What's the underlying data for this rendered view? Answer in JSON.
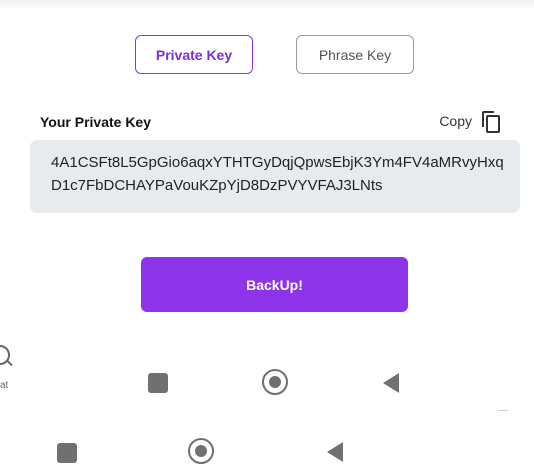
{
  "tabs": {
    "private_key_label": "Private Key",
    "phrase_key_label": "Phrase Key"
  },
  "key_section": {
    "title": "Your Private Key",
    "copy_label": "Copy",
    "private_key_value": "4A1CSFt8L5GpGio6aqxYTHTGyDqjQpwsEbjK3Ym4FV4aMRvyHxqD1c7FbDCHAYPaVouKZpYjD8DzPVYVFAJ3LNts"
  },
  "backup_button": {
    "label": "BackUp!"
  },
  "side_fragment": {
    "text": "at"
  },
  "colors": {
    "accent": "#8d34ea",
    "key_box_bg": "#e8ebee",
    "nav_icon": "#707070"
  },
  "icons": {
    "copy": "copy-icon",
    "search": "search-icon",
    "nav_recent": "square-icon",
    "nav_home": "circle-icon",
    "nav_back": "triangle-back-icon"
  }
}
